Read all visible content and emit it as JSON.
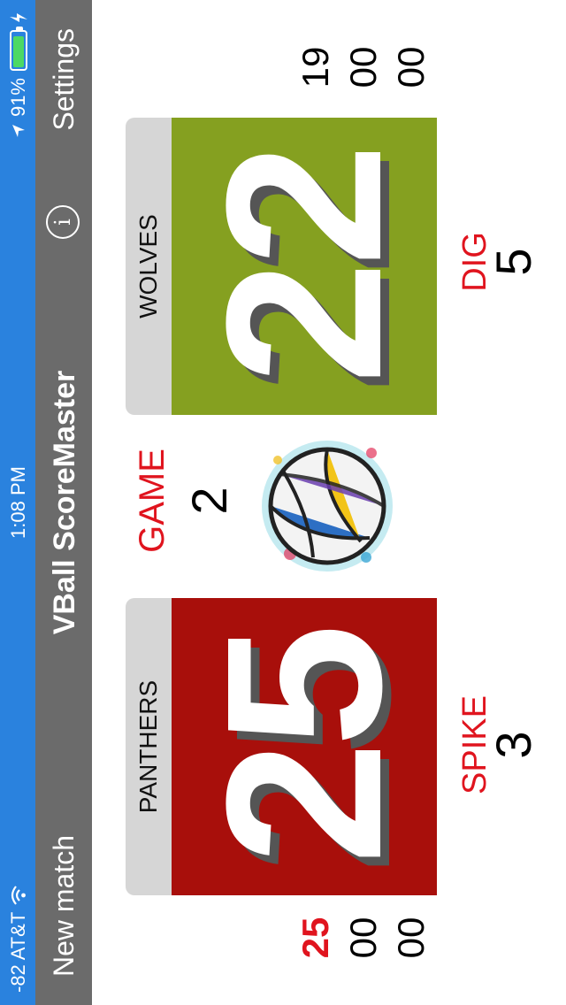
{
  "status_bar": {
    "carrier": "-82 AT&T",
    "time": "1:08 PM",
    "battery": "91%",
    "battery_level": 0.91
  },
  "nav": {
    "left_button": "New match",
    "title": "VBall ScoreMaster",
    "info_glyph": "i",
    "right_button": "Settings"
  },
  "colors": {
    "status_bar": "#2a82de",
    "nav_bar": "#6b6b6b",
    "left_team": "#a80f0b",
    "right_team": "#85a020",
    "accent_red": "#e0141e"
  },
  "left_team": {
    "name": "PANTHERS",
    "score": "25",
    "stat_label": "SPIKE",
    "stat_value": "3",
    "set_scores": [
      "25",
      "00",
      "00"
    ]
  },
  "right_team": {
    "name": "WOLVES",
    "score": "22",
    "stat_label": "DIG",
    "stat_value": "5",
    "set_scores": [
      "19",
      "00",
      "00"
    ]
  },
  "game": {
    "label": "GAME",
    "number": "2",
    "icon": "volleyball-icon"
  }
}
